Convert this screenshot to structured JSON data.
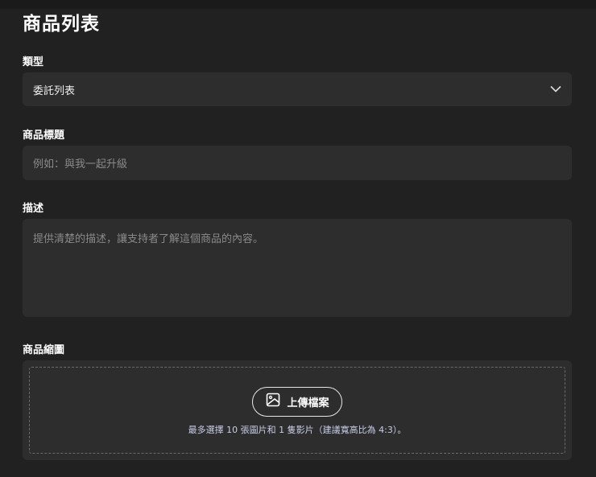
{
  "page": {
    "title": "商品列表"
  },
  "type_field": {
    "label": "類型",
    "value": "委託列表"
  },
  "title_field": {
    "label": "商品標題",
    "placeholder": "例如：與我一起升級"
  },
  "description_field": {
    "label": "描述",
    "placeholder": "提供清楚的描述，讓支持者了解這個商品的內容。"
  },
  "thumbnail_field": {
    "label": "商品縮圖",
    "upload_label": "上傳檔案",
    "hint": "最多選擇 10 張圖片和 1 隻影片（建議寬高比為 4:3）。"
  }
}
